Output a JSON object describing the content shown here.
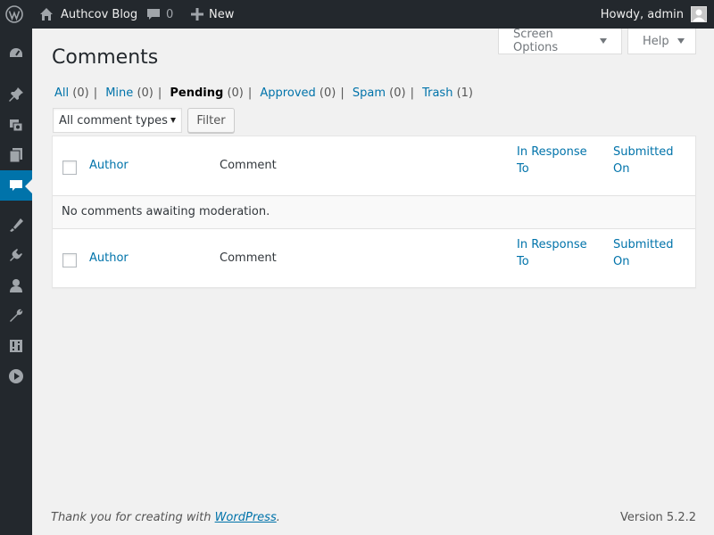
{
  "adminbar": {
    "site_name": "Authcov Blog",
    "comments_count": "0",
    "new_label": "New",
    "greeting": "Howdy, admin"
  },
  "sidebar": {
    "items": [
      {
        "icon": "dashboard-icon"
      },
      {
        "icon": "pin-icon"
      },
      {
        "icon": "media-icon"
      },
      {
        "icon": "pages-icon"
      },
      {
        "icon": "comments-icon",
        "current": true
      },
      {
        "icon": "appearance-icon"
      },
      {
        "icon": "plugins-icon"
      },
      {
        "icon": "users-icon"
      },
      {
        "icon": "tools-icon"
      },
      {
        "icon": "settings-icon"
      },
      {
        "icon": "play-icon"
      }
    ]
  },
  "screen_meta": {
    "screen_options": "Screen Options",
    "help": "Help"
  },
  "page_title": "Comments",
  "filters": {
    "all": {
      "label": "All",
      "count": "(0)"
    },
    "mine": {
      "label": "Mine",
      "count": "(0)"
    },
    "pending": {
      "label": "Pending",
      "count": "(0)"
    },
    "approved": {
      "label": "Approved",
      "count": "(0)"
    },
    "spam": {
      "label": "Spam",
      "count": "(0)"
    },
    "trash": {
      "label": "Trash",
      "count": "(1)"
    },
    "separator": "|"
  },
  "comment_type_select": {
    "value": "All comment types"
  },
  "filter_button": "Filter",
  "table": {
    "columns": {
      "author": "Author",
      "comment": "Comment",
      "in_response_to_1": "In Response",
      "in_response_to_2": "To",
      "submitted_on_1": "Submitted",
      "submitted_on_2": "On"
    },
    "empty_message": "No comments awaiting moderation."
  },
  "footer": {
    "thanks_prefix": "Thank you for creating with ",
    "thanks_link": "WordPress",
    "thanks_suffix": ".",
    "version": "Version 5.2.2"
  },
  "colors": {
    "adminbar_bg": "#23282d",
    "accent": "#0073aa",
    "page_bg": "#f1f1f1"
  }
}
